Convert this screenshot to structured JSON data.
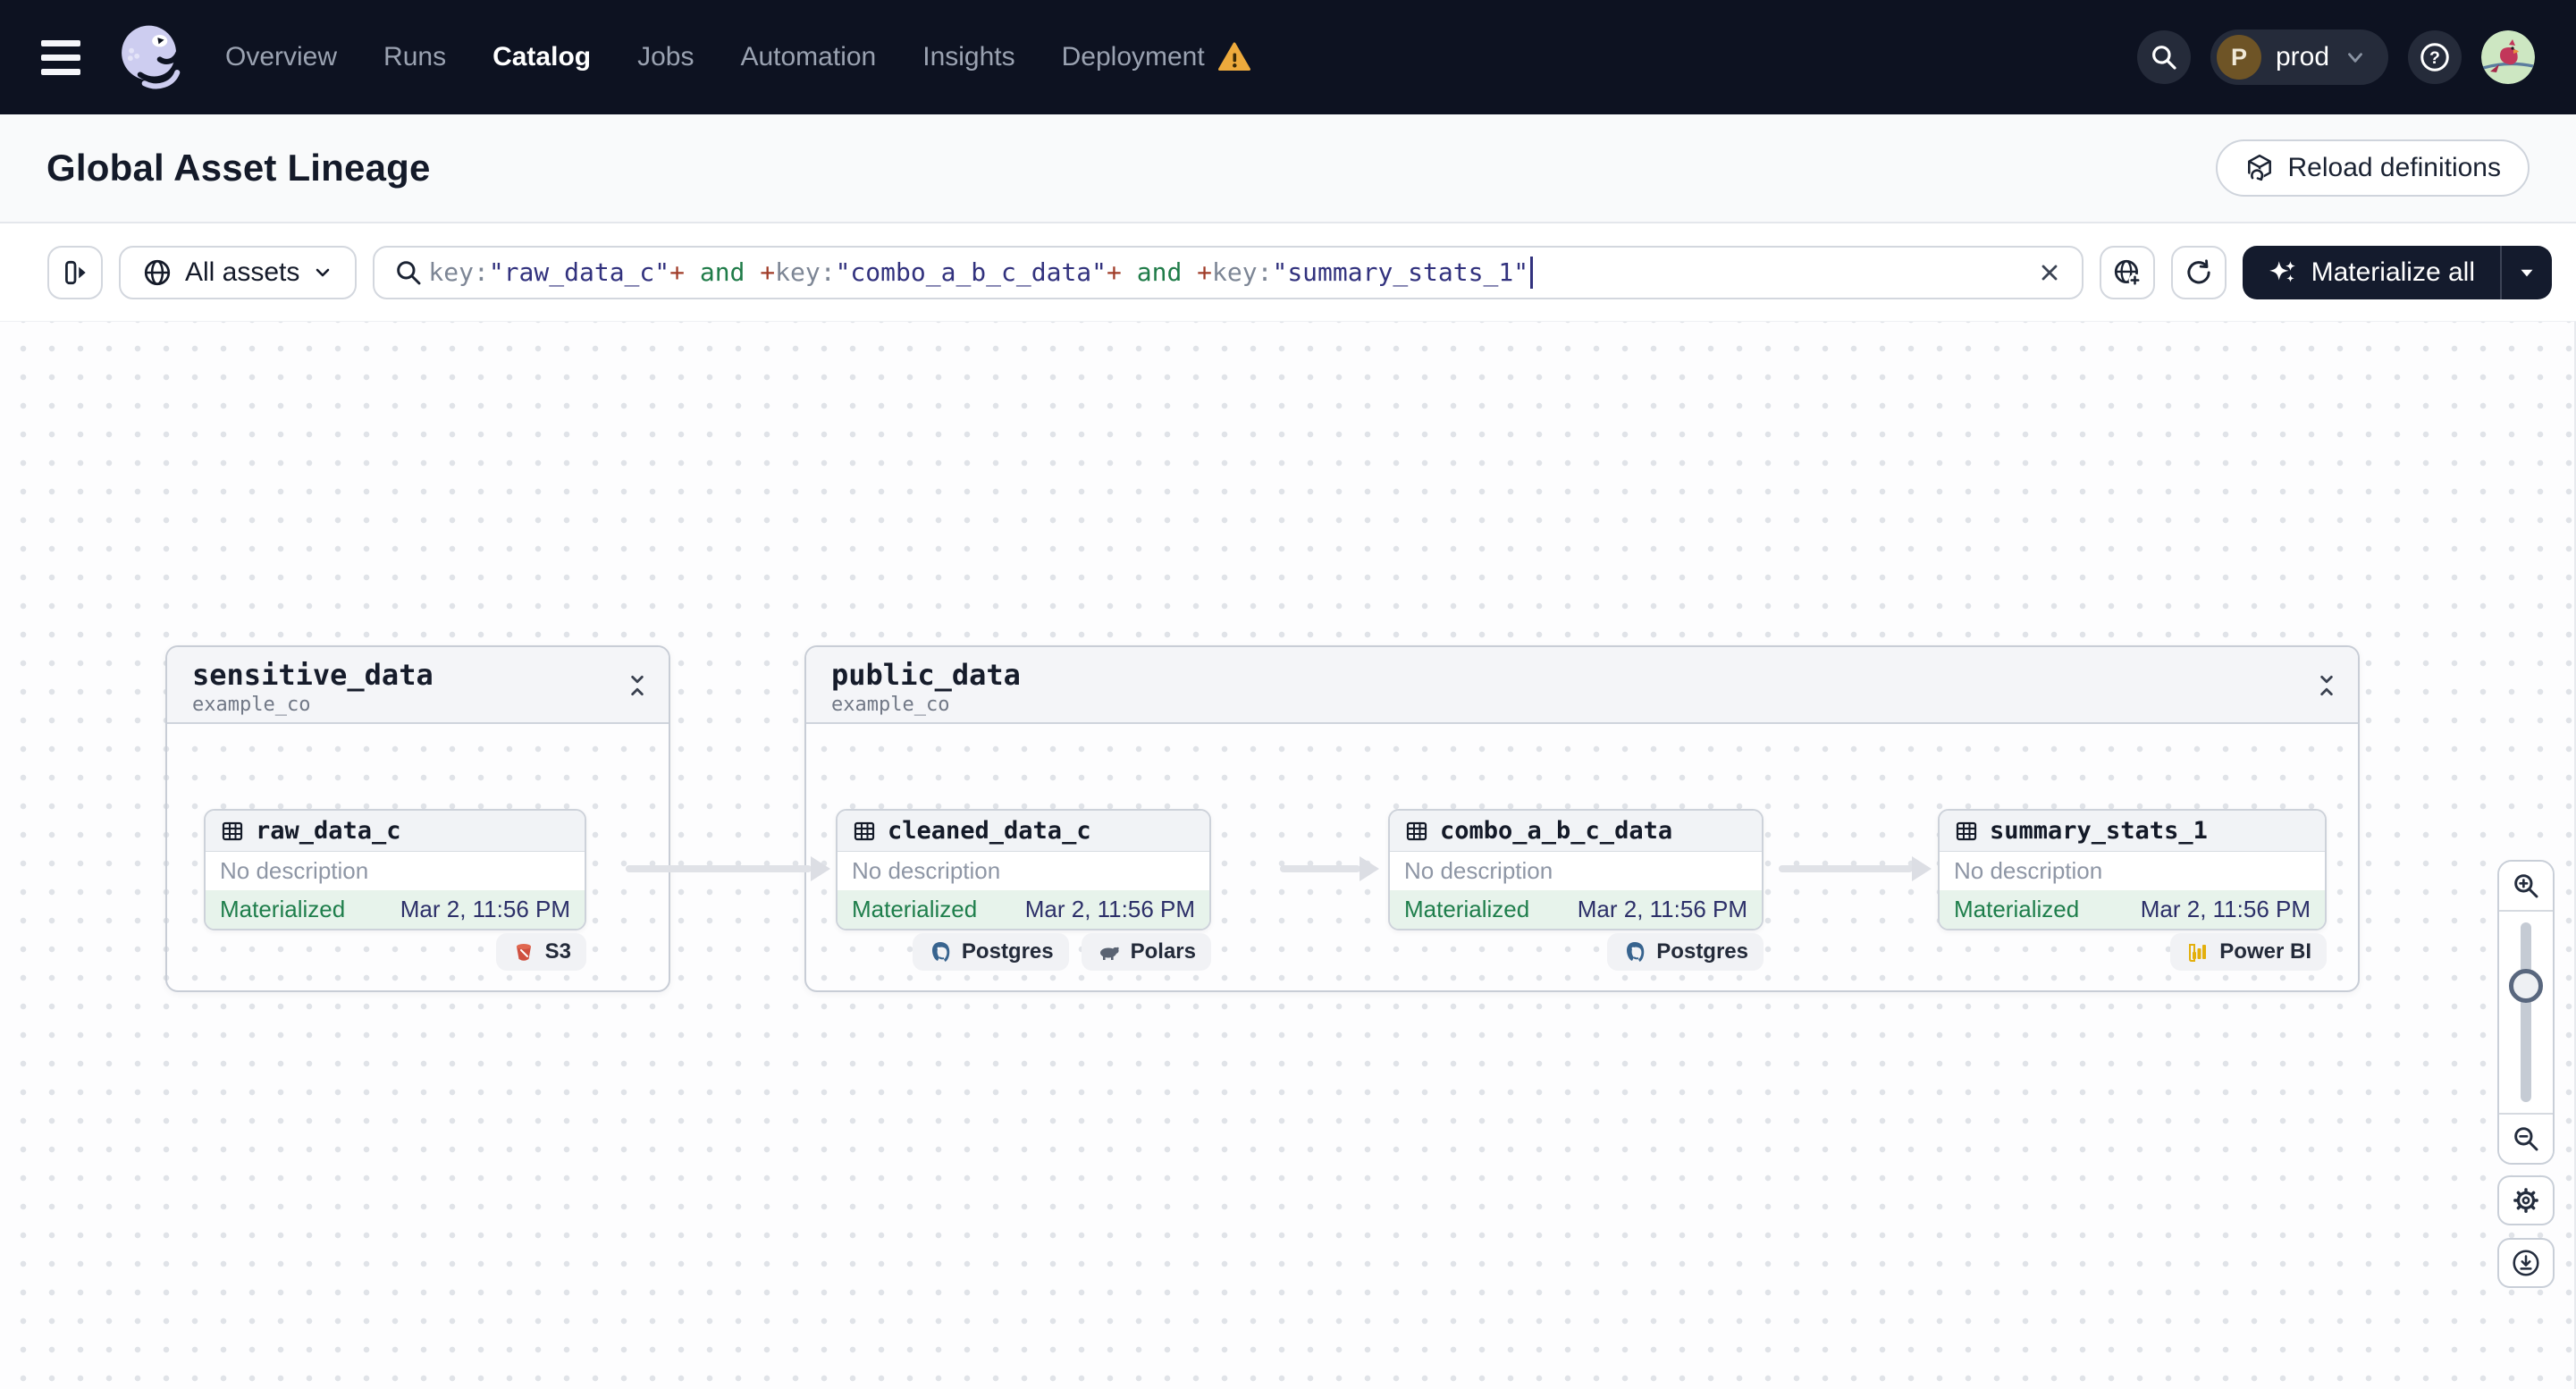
{
  "nav": {
    "items": [
      "Overview",
      "Runs",
      "Catalog",
      "Jobs",
      "Automation",
      "Insights",
      "Deployment"
    ],
    "active_item": "Catalog",
    "environment": {
      "initial": "P",
      "name": "prod"
    }
  },
  "page": {
    "title": "Global Asset Lineage",
    "reload_label": "Reload definitions"
  },
  "filter": {
    "scope_label": "All assets",
    "materialize_label": "Materialize all",
    "query_tokens": [
      {
        "type": "key",
        "text": "key:"
      },
      {
        "type": "str",
        "text": "\"raw_data_c\""
      },
      {
        "type": "op",
        "text": "+"
      },
      {
        "type": "kw",
        "text": " and "
      },
      {
        "type": "op",
        "text": "+"
      },
      {
        "type": "key",
        "text": "key:"
      },
      {
        "type": "str",
        "text": "\"combo_a_b_c_data\""
      },
      {
        "type": "op",
        "text": "+"
      },
      {
        "type": "kw",
        "text": " and "
      },
      {
        "type": "op",
        "text": "+"
      },
      {
        "type": "key",
        "text": "key:"
      },
      {
        "type": "str",
        "text": "\"summary_stats_1\""
      }
    ]
  },
  "graph": {
    "groups": [
      {
        "name": "sensitive_data",
        "location": "example_co"
      },
      {
        "name": "public_data",
        "location": "example_co"
      }
    ],
    "assets": [
      {
        "name": "raw_data_c",
        "description": "No description",
        "status": "Materialized",
        "last_materialized": "Mar 2, 11:56 PM",
        "kinds": [
          "S3"
        ]
      },
      {
        "name": "cleaned_data_c",
        "description": "No description",
        "status": "Materialized",
        "last_materialized": "Mar 2, 11:56 PM",
        "kinds": [
          "Postgres",
          "Polars"
        ]
      },
      {
        "name": "combo_a_b_c_data",
        "description": "No description",
        "status": "Materialized",
        "last_materialized": "Mar 2, 11:56 PM",
        "kinds": [
          "Postgres"
        ]
      },
      {
        "name": "summary_stats_1",
        "description": "No description",
        "status": "Materialized",
        "last_materialized": "Mar 2, 11:56 PM",
        "kinds": [
          "Power BI"
        ]
      }
    ]
  },
  "icons": {
    "menu": "hamburger",
    "brand": "dagster-octopus",
    "deployment_warning": "triangle-exclamation",
    "search": "magnifier",
    "help": "question-circle",
    "reload": "cube-refresh",
    "panel": "expand-panel",
    "scope": "globe",
    "clear": "x",
    "add_scope": "globe-plus",
    "refresh": "sync",
    "materialize": "sparkles",
    "collapse": "chevrons-inward",
    "asset": "table-grid",
    "s3": "red-bucket",
    "postgres": "blue-elephant",
    "polars": "bear",
    "powerbi": "yellow-bars",
    "zoom_in": "magnifier-plus",
    "zoom_out": "magnifier-minus",
    "settings": "gear",
    "download": "arrow-down-circle"
  },
  "colors": {
    "nav_bg": "#0d1221",
    "accent_dark": "#141b2d",
    "warning": "#edaa3c",
    "status_green": "#1e7e4b",
    "status_bg": "#e7f3eb",
    "timestamp_navy": "#2d3069",
    "query_string": "#32327e",
    "query_operator": "#a03c28",
    "query_keyword": "#207c49"
  }
}
